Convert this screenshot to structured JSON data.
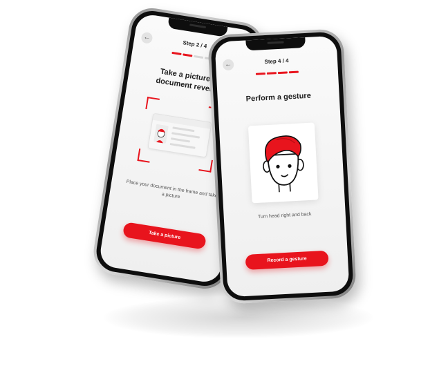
{
  "colors": {
    "accent": "#e8141d",
    "screen_bg": "#f4f4f4"
  },
  "phone1": {
    "back_icon": "arrow-left-icon",
    "back_glyph": "←",
    "step": "Step 2 / 4",
    "progress": {
      "active": 2,
      "total": 4
    },
    "heading_line1": "Take a picture of",
    "heading_line2": "document reverse",
    "hint": "Place your document in the frame and take a picture",
    "button": "Take a picture"
  },
  "phone2": {
    "back_icon": "arrow-left-icon",
    "back_glyph": "←",
    "step": "Step 4 / 4",
    "progress": {
      "active": 4,
      "total": 4
    },
    "heading": "Perform a gesture",
    "hint": "Turn head right and back",
    "button": "Record a gesture"
  }
}
